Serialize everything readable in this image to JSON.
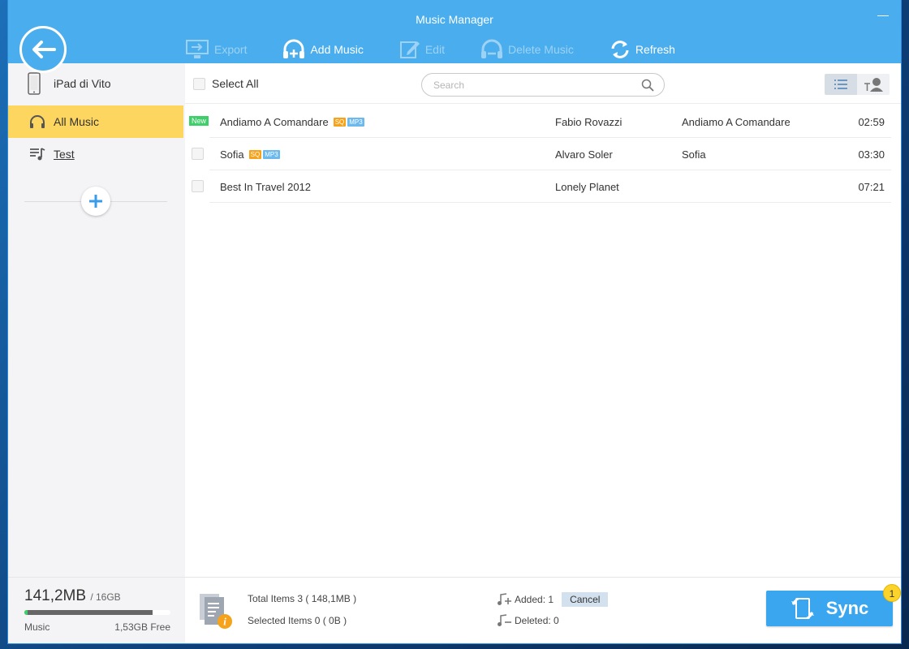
{
  "app": {
    "title": "Music Manager",
    "minimize_glyph": "—"
  },
  "toolbar": {
    "export": "Export",
    "add_music": "Add Music",
    "edit": "Edit",
    "delete_music": "Delete Music",
    "refresh": "Refresh"
  },
  "sidebar": {
    "device": "iPad di Vito",
    "items": [
      {
        "label": "All Music",
        "icon": "headphones-icon",
        "active": true
      },
      {
        "label": "Test",
        "icon": "playlist-icon",
        "active": false
      }
    ]
  },
  "list": {
    "select_all": "Select All",
    "search_placeholder": "Search",
    "rows": [
      {
        "new": "New",
        "title": "Andiamo A Comandare",
        "sq": "SQ",
        "format": "MP3",
        "artist": "Fabio Rovazzi",
        "album": "Andiamo A Comandare",
        "duration": "02:59"
      },
      {
        "title": "Sofia",
        "sq": "SQ",
        "format": "MP3",
        "artist": "Alvaro Soler",
        "album": "Sofia",
        "duration": "03:30"
      },
      {
        "title": "Best In Travel 2012",
        "artist": "Lonely Planet",
        "album": "",
        "duration": "07:21"
      }
    ]
  },
  "storage": {
    "used": "141,2MB",
    "total": "/ 16GB",
    "category": "Music",
    "free": "1,53GB Free",
    "used_fraction": 0.88
  },
  "summary": {
    "total_items_label": "Total Items",
    "total_items_value": "3 ( 148,1MB )",
    "selected_items_label": "Selected Items",
    "selected_items_value": "0 ( 0B )",
    "added_label": "Added:",
    "added_value": "1",
    "cancel": "Cancel",
    "deleted_label": "Deleted:",
    "deleted_value": "0"
  },
  "sync": {
    "label": "Sync",
    "count": "1"
  },
  "colors": {
    "titlebar": "#4aaeee",
    "active_nav": "#fdd660",
    "sync": "#3aa6ef",
    "new_badge": "#3fcf6a",
    "sq_badge": "#f6a21a",
    "mp3_badge": "#6cb9ee"
  }
}
